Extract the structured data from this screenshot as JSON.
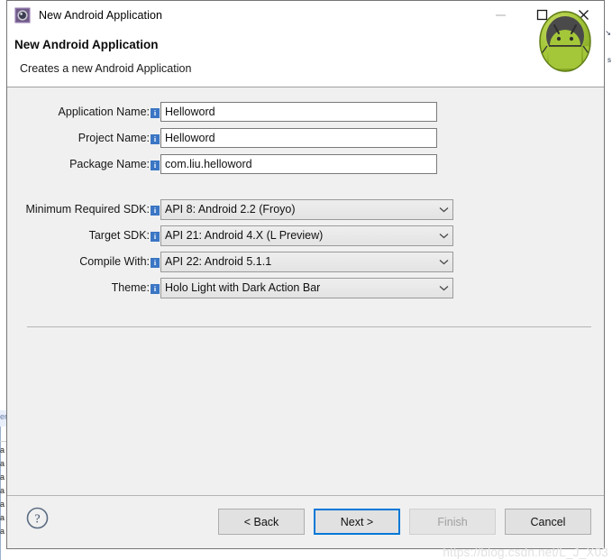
{
  "window": {
    "title": "New Android Application",
    "icon": "android-settings-icon",
    "controls": {
      "minimize": "minimize-icon",
      "maximize": "maximize-icon",
      "close": "close-icon"
    }
  },
  "header": {
    "title": "New Android Application",
    "subtitle": "Creates a new Android Application",
    "logo": "android-robot-logo"
  },
  "form": {
    "text_fields": [
      {
        "label": "Application Name:",
        "value": "Helloword",
        "info": "info-icon"
      },
      {
        "label": "Project Name:",
        "value": "Helloword",
        "info": "info-icon"
      },
      {
        "label": "Package Name:",
        "value": "com.liu.helloword",
        "info": "info-icon"
      }
    ],
    "dropdowns": [
      {
        "label": "Minimum Required SDK:",
        "value": "API 8: Android 2.2 (Froyo)",
        "info": "info-icon"
      },
      {
        "label": "Target SDK:",
        "value": "API 21: Android 4.X (L Preview)",
        "info": "info-icon"
      },
      {
        "label": "Compile With:",
        "value": "API 22: Android 5.1.1",
        "info": "info-icon"
      },
      {
        "label": "Theme:",
        "value": "Holo Light with Dark Action Bar",
        "info": "info-icon"
      }
    ]
  },
  "footer": {
    "help": "help-icon",
    "buttons": [
      {
        "label": "< Back",
        "state": "enabled"
      },
      {
        "label": "Next >",
        "state": "default"
      },
      {
        "label": "Finish",
        "state": "disabled"
      },
      {
        "label": "Cancel",
        "state": "enabled"
      }
    ]
  },
  "watermark": {
    "text": "https://blog.csdn.net/L_J_X03"
  },
  "background": {
    "left_text": [
      "er",
      "a",
      "a",
      "a",
      "a",
      "a",
      "a",
      "a"
    ],
    "right_glyphs": [
      "↘",
      "s"
    ]
  },
  "colors": {
    "accent": "#0078d7",
    "info_badge": "#3a76c4",
    "dialog_bg": "#f0f0f0",
    "android_green": "#a4c639"
  }
}
